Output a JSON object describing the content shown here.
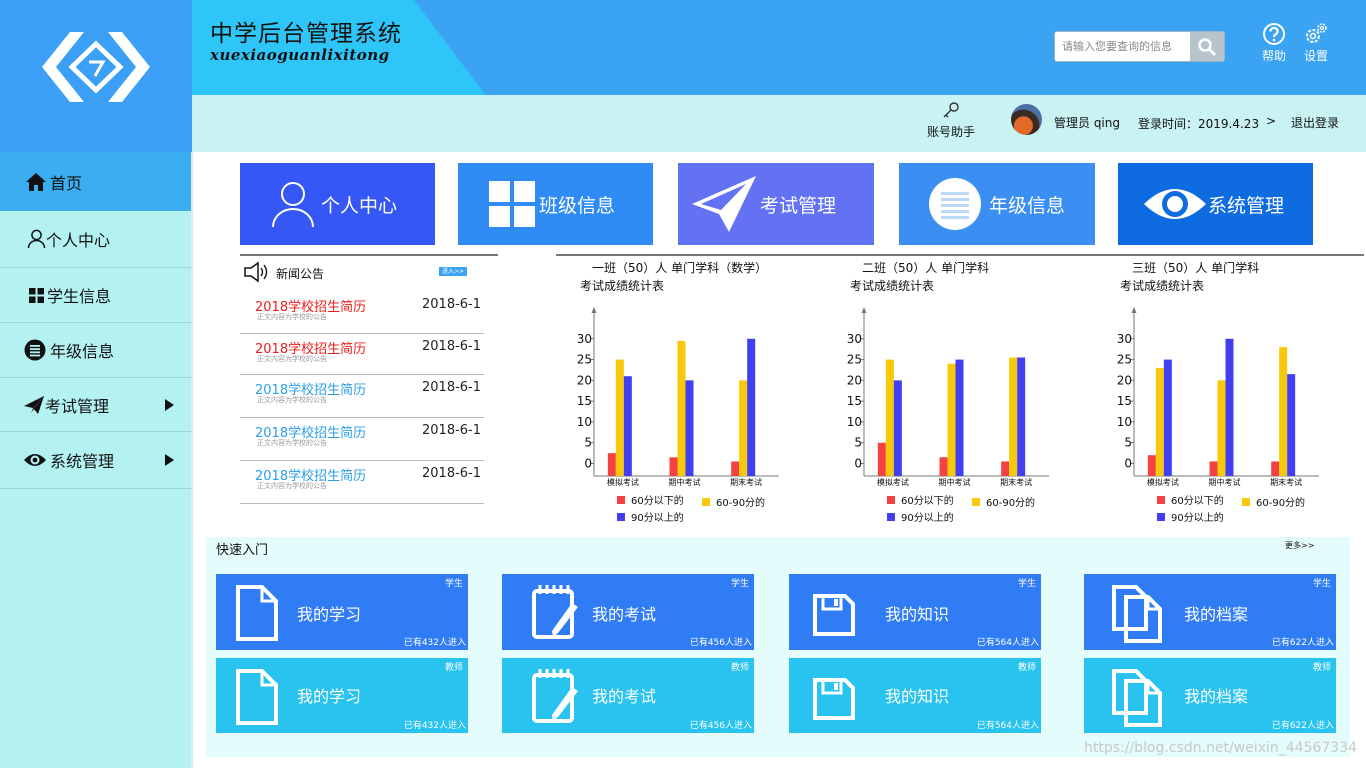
{
  "header": {
    "title": "中学后台管理系统",
    "subtitle": "xuexiaoguanlixitong",
    "search": {
      "placeholder": "请输入您要查询的信息",
      "value": ""
    },
    "help_label": "帮助",
    "settings_label": "设置",
    "account_helper_label": "账号助手",
    "user_label": "管理员 qing",
    "login_time": "登录时间：2019.4.23",
    "login_time_arrow": ">",
    "logout_label": "退出登录"
  },
  "sidebar": {
    "items": [
      {
        "label": "首页",
        "icon": "home-icon",
        "active": true
      },
      {
        "label": "个人中心",
        "icon": "user-icon"
      },
      {
        "label": "学生信息",
        "icon": "grid-icon"
      },
      {
        "label": "年级信息",
        "icon": "list-circle-icon"
      },
      {
        "label": "考试管理",
        "icon": "paper-plane-icon",
        "expandable": true
      },
      {
        "label": "系统管理",
        "icon": "eye-icon",
        "expandable": true
      }
    ]
  },
  "nav_tiles": [
    {
      "label": "个人中心",
      "icon": "user-icon",
      "color": "#3557f5"
    },
    {
      "label": "班级信息",
      "icon": "grid-icon",
      "color": "#2f8cf5"
    },
    {
      "label": "考试管理",
      "icon": "paper-plane-icon",
      "color": "#6372f3"
    },
    {
      "label": "年级信息",
      "icon": "list-circle-icon",
      "color": "#3b8ff3"
    },
    {
      "label": "系统管理",
      "icon": "eye-icon",
      "color": "#0f6ce0"
    }
  ],
  "news": {
    "title": "新闻公告",
    "more_label": "进入>>",
    "items": [
      {
        "title": "2018学校招生简历",
        "summary": "正文内容为学校的公告",
        "date": "2018-6-1",
        "color": "#ef1c1c"
      },
      {
        "title": "2018学校招生简历",
        "summary": "正文内容为学校的公告",
        "date": "2018-6-1",
        "color": "#ef1c1c"
      },
      {
        "title": "2018学校招生简历",
        "summary": "正文内容为学校的公告",
        "date": "2018-6-1",
        "color": "#2a9ee8"
      },
      {
        "title": "2018学校招生简历",
        "summary": "正文内容为学校的公告",
        "date": "2018-6-1",
        "color": "#2a9ee8"
      },
      {
        "title": "2018学校招生简历",
        "summary": "正文内容为学校的公告",
        "date": "2018-6-1",
        "color": "#2a9ee8"
      }
    ]
  },
  "chart_data": [
    {
      "type": "bar",
      "title": "一班（50）人   单门学科（数学）",
      "subtitle": "考试成绩统计表",
      "categories": [
        "模拟考试",
        "期中考试",
        "期末考试"
      ],
      "yticks": [
        0,
        5,
        10,
        15,
        20,
        25,
        30
      ],
      "ylim": [
        -3,
        35
      ],
      "series": [
        {
          "name": "60分以下的",
          "color": "#f44242",
          "values": [
            2.5,
            1.5,
            0.5
          ]
        },
        {
          "name": "60-90分的",
          "color": "#f8c90a",
          "values": [
            25,
            29.5,
            20
          ]
        },
        {
          "name": "90分以上的",
          "color": "#4040f2",
          "values": [
            21,
            20,
            30
          ]
        }
      ]
    },
    {
      "type": "bar",
      "title": "二班（50）人   单门学科",
      "subtitle": "考试成绩统计表",
      "categories": [
        "模拟考试",
        "期中考试",
        "期末考试"
      ],
      "yticks": [
        0,
        5,
        10,
        15,
        20,
        25,
        30
      ],
      "ylim": [
        -3,
        35
      ],
      "series": [
        {
          "name": "60分以下的",
          "color": "#f44242",
          "values": [
            5,
            1.5,
            0.5
          ]
        },
        {
          "name": "60-90分的",
          "color": "#f8c90a",
          "values": [
            25,
            24,
            25.5
          ]
        },
        {
          "name": "90分以上的",
          "color": "#4040f2",
          "values": [
            20,
            25,
            25.5
          ]
        }
      ]
    },
    {
      "type": "bar",
      "title": "三班（50）人   单门学科",
      "subtitle": "考试成绩统计表",
      "categories": [
        "模拟考试",
        "期中考试",
        "期末考试"
      ],
      "yticks": [
        0,
        5,
        10,
        15,
        20,
        25,
        30
      ],
      "ylim": [
        -3,
        35
      ],
      "series": [
        {
          "name": "60分以下的",
          "color": "#f44242",
          "values": [
            2,
            0.5,
            0.5
          ]
        },
        {
          "name": "60-90分的",
          "color": "#f8c90a",
          "values": [
            23,
            20,
            28
          ]
        },
        {
          "name": "90分以上的",
          "color": "#4040f2",
          "values": [
            25,
            30,
            21.5
          ]
        }
      ]
    }
  ],
  "quick": {
    "title": "快速入门",
    "more_label": "更多>>",
    "rows": [
      {
        "color": "#2f7cf5",
        "cards": [
          {
            "label": "我的学习",
            "role": "学生",
            "count": "已有432人进入",
            "icon": "document-icon"
          },
          {
            "label": "我的考试",
            "role": "学生",
            "count": "已有456人进入",
            "icon": "notebook-pen-icon"
          },
          {
            "label": "我的知识",
            "role": "学生",
            "count": "已有564人进入",
            "icon": "floppy-disk-icon"
          },
          {
            "label": "我的档案",
            "role": "学生",
            "count": "已有622人进入",
            "icon": "copy-files-icon"
          }
        ]
      },
      {
        "color": "#28c3ef",
        "cards": [
          {
            "label": "我的学习",
            "role": "教师",
            "count": "已有432人进入",
            "icon": "document-icon"
          },
          {
            "label": "我的考试",
            "role": "教师",
            "count": "已有456人进入",
            "icon": "notebook-pen-icon"
          },
          {
            "label": "我的知识",
            "role": "教师",
            "count": "已有564人进入",
            "icon": "floppy-disk-icon"
          },
          {
            "label": "我的档案",
            "role": "教师",
            "count": "已有622人进入",
            "icon": "copy-files-icon"
          }
        ]
      }
    ]
  },
  "watermark": "https://blog.csdn.net/weixin_44567334"
}
